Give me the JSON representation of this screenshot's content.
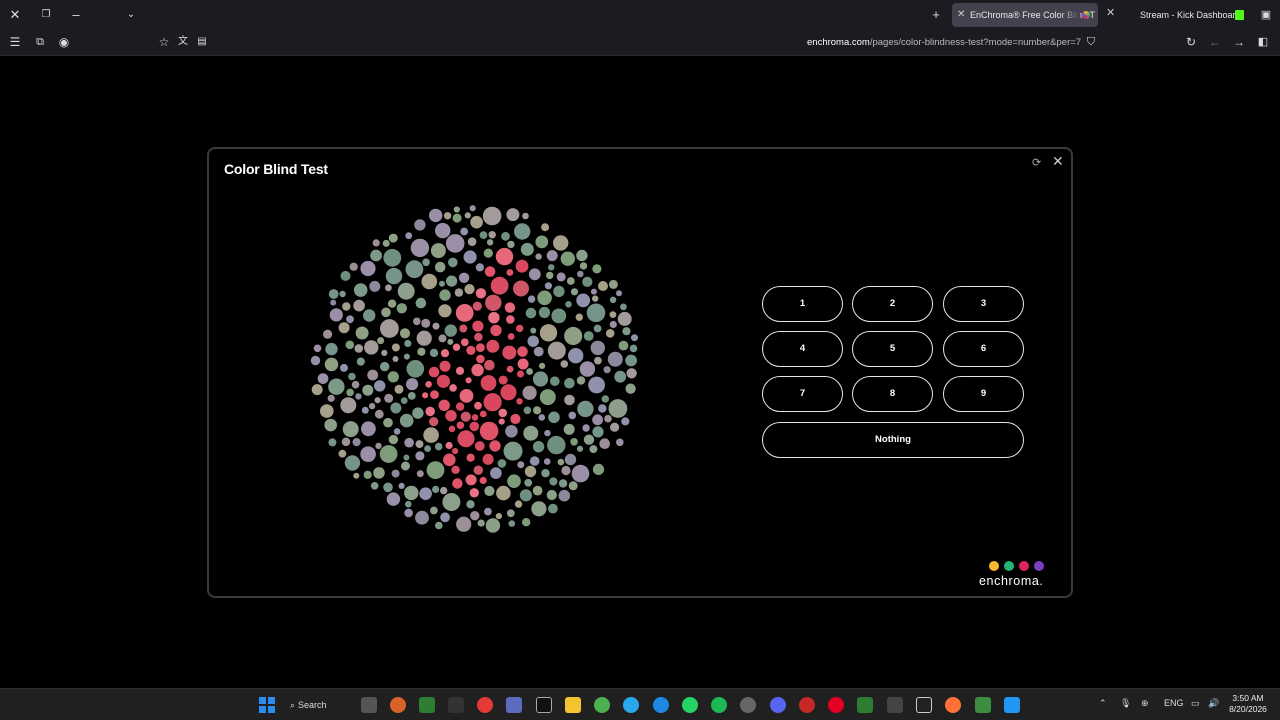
{
  "browser": {
    "tabs": [
      {
        "title": "EnChroma® Free Color Blind T",
        "active": true
      },
      {
        "title": "Stream - Kick Dashboard",
        "active": false
      }
    ],
    "url_domain": "enchroma.com",
    "url_path": "/pages/color-blindness-test?mode=number&per=7"
  },
  "modal": {
    "title": "Color Blind Test",
    "refresh_icon": "refresh-icon",
    "close_icon": "close-icon"
  },
  "answers": [
    {
      "label": "1"
    },
    {
      "label": "2"
    },
    {
      "label": "3"
    },
    {
      "label": "4"
    },
    {
      "label": "5"
    },
    {
      "label": "6"
    },
    {
      "label": "7"
    },
    {
      "label": "8"
    },
    {
      "label": "9"
    }
  ],
  "nothing_label": "Nothing",
  "brand": {
    "name": "enchroma.",
    "dot_colors": [
      "#f5b82e",
      "#22b573",
      "#e0245e",
      "#7b3fc4"
    ]
  },
  "plate": {
    "background_colors": [
      "#7d9a88",
      "#8b9f8b",
      "#6f8f7f",
      "#9a8fa6",
      "#8a8a9c",
      "#a6a08a",
      "#7f9c7a",
      "#9d8f97",
      "#76948a",
      "#8e9f84",
      "#9091aa",
      "#a39a9a"
    ],
    "figure_colors": [
      "#e0546a",
      "#d94c63",
      "#e6687a",
      "#cf5569",
      "#e87287",
      "#d8475e"
    ]
  },
  "taskbar": {
    "search_label": "Search",
    "language": "ENG",
    "time": "3:50 AM",
    "date": "8/20/2026"
  }
}
